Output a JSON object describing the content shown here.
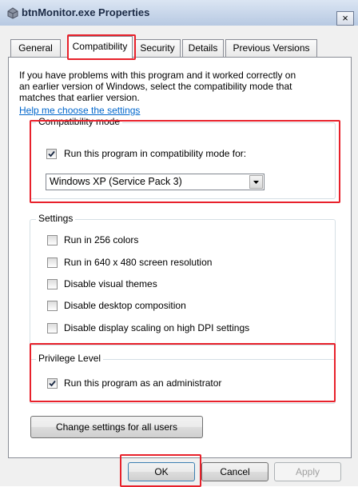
{
  "window": {
    "title": "btnMonitor.exe Properties",
    "close_glyph": "×",
    "icon": "program-properties-icon"
  },
  "tabs": [
    {
      "label": "General"
    },
    {
      "label": "Compatibility",
      "active": true
    },
    {
      "label": "Security"
    },
    {
      "label": "Details"
    },
    {
      "label": "Previous Versions"
    }
  ],
  "intro": {
    "line1": "If you have problems with this program and it worked correctly on",
    "line2": "an earlier version of Windows, select the compatibility mode that",
    "line3": "matches that earlier version.",
    "help_link": "Help me choose the settings"
  },
  "compat_mode": {
    "legend": "Compatibility mode",
    "checkbox_label": "Run this program in compatibility mode for:",
    "checked": true,
    "selected_os": "Windows XP (Service Pack 3)"
  },
  "settings": {
    "legend": "Settings",
    "items": [
      {
        "label": "Run in 256 colors",
        "checked": false
      },
      {
        "label": "Run in 640 x 480 screen resolution",
        "checked": false
      },
      {
        "label": "Disable visual themes",
        "checked": false
      },
      {
        "label": "Disable desktop composition",
        "checked": false
      },
      {
        "label": "Disable display scaling on high DPI settings",
        "checked": false
      }
    ]
  },
  "privilege": {
    "legend": "Privilege Level",
    "checkbox_label": "Run this program as an administrator",
    "checked": true
  },
  "change_all_users_label": "Change settings for all users",
  "buttons": {
    "ok": "OK",
    "cancel": "Cancel",
    "apply": "Apply"
  },
  "colors": {
    "highlight": "#e8212b",
    "link": "#0066cc",
    "dialog_bg": "#f0f0f0"
  }
}
